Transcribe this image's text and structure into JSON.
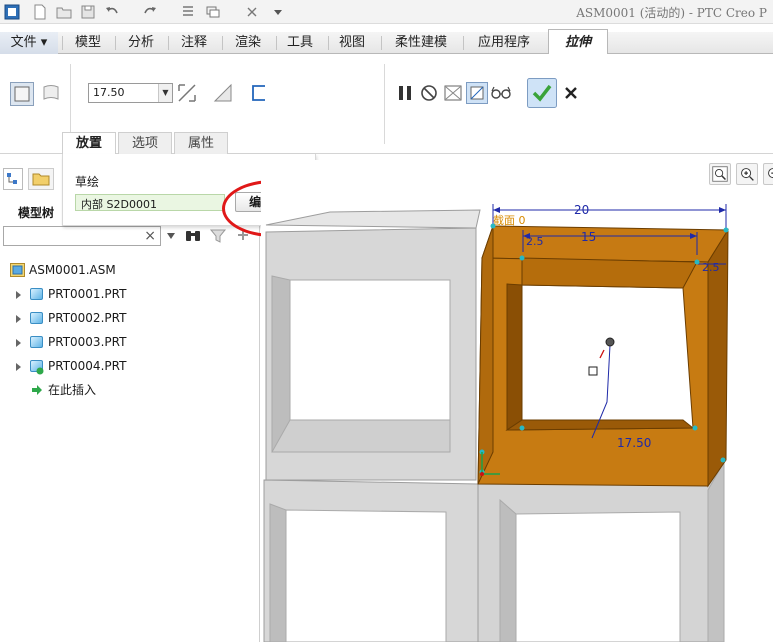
{
  "window": {
    "title": "ASM0001 (活动的) - PTC Creo P"
  },
  "ribbon_tabs": [
    {
      "label": "文件 ▾"
    },
    {
      "label": "模型"
    },
    {
      "label": "分析"
    },
    {
      "label": "注释"
    },
    {
      "label": "渲染"
    },
    {
      "label": "工具"
    },
    {
      "label": "视图"
    },
    {
      "label": "柔性建模"
    },
    {
      "label": "应用程序"
    },
    {
      "label": "拉伸"
    }
  ],
  "extrude": {
    "depth_value": "17.50"
  },
  "sub_tabs": [
    {
      "label": "放置"
    },
    {
      "label": "选项"
    },
    {
      "label": "属性"
    }
  ],
  "placement": {
    "section_label": "草绘",
    "sketch_value": "内部 S2D0001",
    "edit_button": "编辑..."
  },
  "model_tree": {
    "title": "模型树",
    "search_placeholder": "",
    "root": "ASM0001.ASM",
    "items": [
      {
        "label": "PRT0001.PRT"
      },
      {
        "label": "PRT0002.PRT"
      },
      {
        "label": "PRT0003.PRT"
      },
      {
        "label": "PRT0004.PRT"
      }
    ],
    "insert_here": "在此插入"
  },
  "viewport": {
    "dim_overall": "20",
    "dim_inner": "15",
    "dim_wall_left": "2.5",
    "dim_wall_right": "2.5",
    "dim_depth": "17.50",
    "sketch_plane_label": "截面 0"
  },
  "colors": {
    "extrude_face": "#c77b12",
    "extrude_dark": "#9a5a08",
    "existing_part": "#d7d7d7",
    "dimension_blue": "#1f2aa8",
    "confirm_green": "#3aa33a",
    "highlight_red": "#e01818"
  },
  "icons": {
    "pause": "pause-icon",
    "stop": "no-entry-icon",
    "preview": "glasses-icon",
    "ok": "checkmark-icon",
    "cancel": "close-icon"
  }
}
